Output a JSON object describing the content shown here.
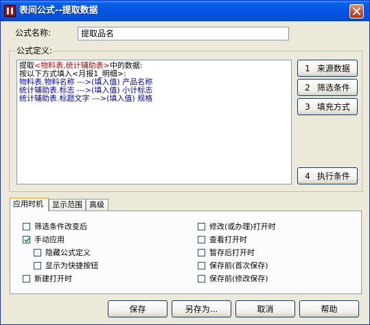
{
  "window": {
    "title": "表间公式--提取数据"
  },
  "name_row": {
    "label": "公式名称:",
    "value": "提取品名"
  },
  "definition": {
    "group_label": "公式定义:",
    "lines": [
      {
        "segments": [
          {
            "text": "提取",
            "color": "black"
          },
          {
            "text": "<物料表,统计辅助表>",
            "color": "red"
          },
          {
            "text": "中的数据:",
            "color": "black"
          }
        ]
      },
      {
        "segments": [
          {
            "text": "按以下方式填入<月报1_明细>:",
            "color": "black"
          }
        ]
      },
      {
        "segments": [
          {
            "text": "物料表.物料名称  --->(填入值)  产品名称",
            "color": "blue"
          }
        ]
      },
      {
        "segments": [
          {
            "text": "统计辅助表.标志  --->(填入值)  小计标志",
            "color": "blue"
          }
        ]
      },
      {
        "segments": [
          {
            "text": "统计辅助表.标题文字  --->(填入值)  规格",
            "color": "blue"
          }
        ]
      }
    ]
  },
  "side_buttons": [
    {
      "num": "1",
      "label": "来源数据"
    },
    {
      "num": "2",
      "label": "筛选条件"
    },
    {
      "num": "3",
      "label": "填充方式"
    },
    {
      "num": "4",
      "label": "执行条件"
    }
  ],
  "tabs": [
    {
      "label": "应用时机"
    },
    {
      "label": "显示范围"
    },
    {
      "label": "高级"
    }
  ],
  "options_left": [
    {
      "label": "筛选条件改变后",
      "checked": false
    },
    {
      "label": "手动应用",
      "checked": true
    },
    {
      "label": "隐藏公式定义",
      "checked": false
    },
    {
      "label": "显示为快捷按钮",
      "checked": false
    },
    {
      "label": "新建打开时",
      "checked": false
    }
  ],
  "options_right": [
    {
      "label": "修改(或办理)打开时",
      "checked": false
    },
    {
      "label": "查看打开时",
      "checked": false
    },
    {
      "label": "暂存后打开时",
      "checked": false
    },
    {
      "label": "保存前(首次保存)",
      "checked": false
    },
    {
      "label": "保存前(修改保存)",
      "checked": false
    }
  ],
  "bottom_buttons": {
    "save": "保存",
    "save_as": "另存为...",
    "cancel": "取消",
    "help": "帮助"
  }
}
